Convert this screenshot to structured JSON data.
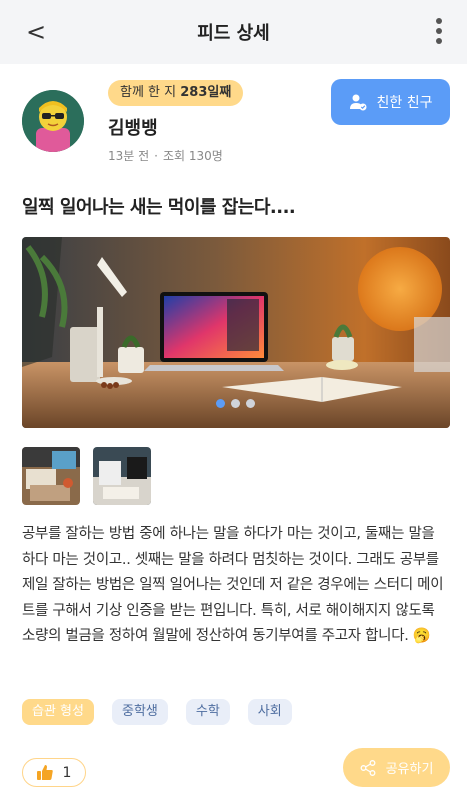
{
  "header": {
    "title": "피드 상세",
    "back_icon": "chevron-left-icon",
    "more_icon": "more-vertical-icon"
  },
  "profile": {
    "days_prefix": "함께 한 지 ",
    "days_value": "283일째",
    "name": "김뱅뱅",
    "time_ago": "13분 전",
    "views": "조회 130명"
  },
  "friend_button": {
    "label": "친한 친구",
    "icon": "user-check-icon"
  },
  "post": {
    "title": "일찍 일어나는 새는 먹이를 잡는다....",
    "body": "공부를 잘하는 방법 중에 하나는 말을 하다가 마는 것이고, 둘째는 말을 하다 마는 것이고.. 셋째는 말을 하려다 멈칫하는 것이다. 그래도 공부를 제일 잘하는 방법은 일찍 일어나는 것인데 저 같은 경우에는 스터디 메이트를 구해서 기상 인증을 받는 편입니다. 특히, 서로 해이해지지 않도록 소량의 벌금을 정하여 월말에 정산하여 동기부여를 주고자 합니다. 🥱"
  },
  "tags": [
    "습관 형성",
    "중학생",
    "수학",
    "사회"
  ],
  "actions": {
    "like_count": "1",
    "like_icon": "thumbs-up-icon",
    "share_label": "공유하기",
    "share_icon": "share-icon"
  },
  "colors": {
    "accent_blue": "#5b9cf7",
    "accent_yellow": "#ffd98a",
    "tag_bg": "#e9eef8"
  }
}
